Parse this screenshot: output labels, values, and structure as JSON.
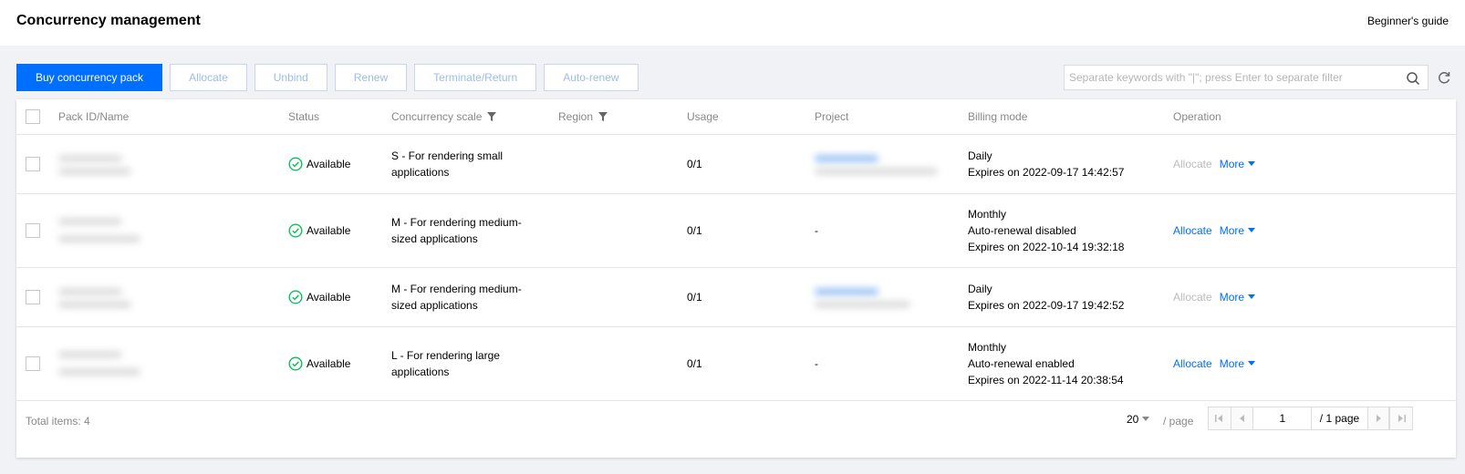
{
  "header": {
    "title": "Concurrency management",
    "guide": "Beginner's guide"
  },
  "toolbar": {
    "buy": "Buy concurrency pack",
    "allocate": "Allocate",
    "unbind": "Unbind",
    "renew": "Renew",
    "terminate": "Terminate/Return",
    "auto_renew": "Auto-renew"
  },
  "search": {
    "placeholder": "Separate keywords with \"|\"; press Enter to separate filter"
  },
  "table": {
    "headers": {
      "pack": "Pack ID/Name",
      "status": "Status",
      "scale": "Concurrency scale",
      "region": "Region",
      "usage": "Usage",
      "project": "Project",
      "billing": "Billing mode",
      "operation": "Operation"
    },
    "rows": [
      {
        "status": "Available",
        "scale1": "S - For rendering small",
        "scale2": "applications",
        "usage": "0/1",
        "project": "",
        "billing1": "Daily",
        "billing2": "Expires on 2022-09-17 14:42:57",
        "billing3": "",
        "allocate": "Allocate",
        "more": "More"
      },
      {
        "status": "Available",
        "scale1": "M - For rendering medium-",
        "scale2": "sized applications",
        "usage": "0/1",
        "project": "-",
        "billing1": "Monthly",
        "billing2": "Auto-renewal disabled",
        "billing3": "Expires on 2022-10-14 19:32:18",
        "allocate": "Allocate",
        "more": "More"
      },
      {
        "status": "Available",
        "scale1": "M - For rendering medium-",
        "scale2": "sized applications",
        "usage": "0/1",
        "project": "",
        "billing1": "Daily",
        "billing2": "Expires on 2022-09-17 19:42:52",
        "billing3": "",
        "allocate": "Allocate",
        "more": "More"
      },
      {
        "status": "Available",
        "scale1": "L - For rendering large",
        "scale2": "applications",
        "usage": "0/1",
        "project": "-",
        "billing1": "Monthly",
        "billing2": "Auto-renewal enabled",
        "billing3": "Expires on 2022-11-14 20:38:54",
        "allocate": "Allocate",
        "more": "More"
      }
    ]
  },
  "footer": {
    "total": "Total items:  4",
    "page_size": "20",
    "per_page": "/ page",
    "page_value": "1",
    "page_total": "/ 1 page"
  },
  "colors": {
    "accent": "#006eff",
    "success": "#0abf5b",
    "muted": "#888888"
  }
}
